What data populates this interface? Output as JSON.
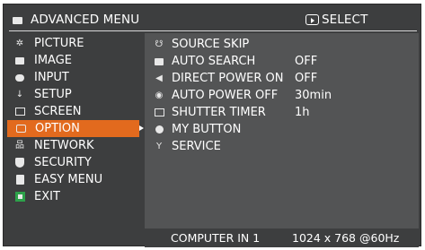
{
  "header": {
    "title": "ADVANCED MENU",
    "select_label": "SELECT",
    "menu_icon": "menu-icon",
    "select_icon": "select-key-icon"
  },
  "sidebar": {
    "items": [
      {
        "label": "PICTURE",
        "icon": "picture-icon"
      },
      {
        "label": "IMAGE",
        "icon": "image-icon"
      },
      {
        "label": "INPUT",
        "icon": "input-icon"
      },
      {
        "label": "SETUP",
        "icon": "setup-icon"
      },
      {
        "label": "SCREEN",
        "icon": "screen-icon"
      },
      {
        "label": "OPTION",
        "icon": "option-icon",
        "selected": true
      },
      {
        "label": "NETWORK",
        "icon": "network-icon"
      },
      {
        "label": "SECURITY",
        "icon": "security-icon"
      },
      {
        "label": "EASY MENU",
        "icon": "easy-menu-icon"
      },
      {
        "label": "EXIT",
        "icon": "exit-icon"
      }
    ]
  },
  "options": {
    "items": [
      {
        "label": "SOURCE SKIP",
        "value": "",
        "icon": "source-skip-icon"
      },
      {
        "label": "AUTO SEARCH",
        "value": "OFF",
        "icon": "auto-search-icon"
      },
      {
        "label": "DIRECT POWER ON",
        "value": "OFF",
        "icon": "direct-power-on-icon"
      },
      {
        "label": "AUTO POWER OFF",
        "value": "30min",
        "icon": "auto-power-off-icon"
      },
      {
        "label": "SHUTTER TIMER",
        "value": "1h",
        "icon": "shutter-timer-icon"
      },
      {
        "label": "MY BUTTON",
        "value": "",
        "icon": "my-button-icon"
      },
      {
        "label": "SERVICE",
        "value": "",
        "icon": "service-icon"
      }
    ]
  },
  "footer": {
    "source": "COMPUTER IN 1",
    "resolution": "1024 x 768 @60Hz"
  },
  "colors": {
    "background": "#3d3e3f",
    "panel": "#535455",
    "highlight": "#e26a1e",
    "text": "#ffffff"
  }
}
